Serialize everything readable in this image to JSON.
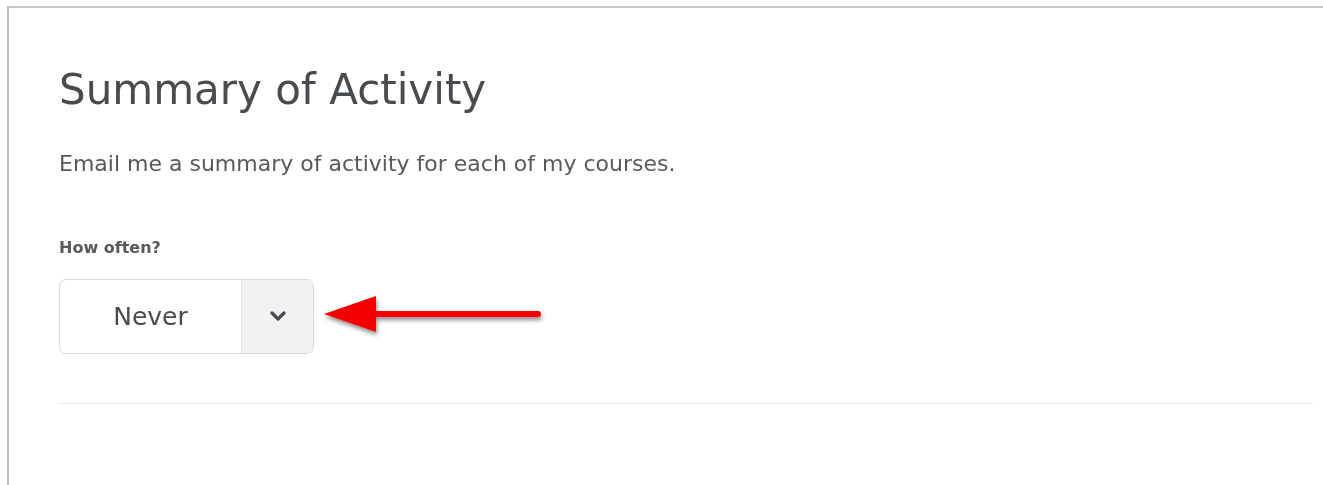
{
  "title": "Summary of Activity",
  "description": "Email me a summary of activity for each of my courses.",
  "frequency": {
    "label": "How often?",
    "value": "Never"
  }
}
